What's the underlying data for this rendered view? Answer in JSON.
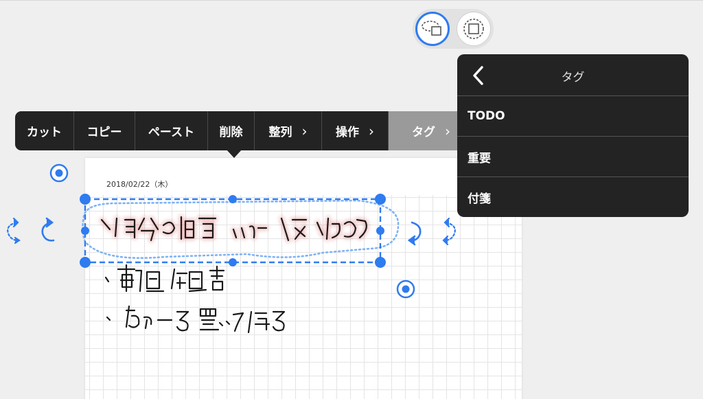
{
  "selection_mode": {
    "options": [
      {
        "name": "lasso",
        "icon": "lasso-select-icon",
        "selected": true
      },
      {
        "name": "rectangle",
        "icon": "rectangle-select-icon",
        "selected": false
      }
    ]
  },
  "context_menu": {
    "items": [
      {
        "id": "cut",
        "label": "カット",
        "has_submenu": false
      },
      {
        "id": "copy",
        "label": "コピー",
        "has_submenu": false
      },
      {
        "id": "paste",
        "label": "ペースト",
        "has_submenu": false
      },
      {
        "id": "delete",
        "label": "削除",
        "has_submenu": false
      },
      {
        "id": "align",
        "label": "整列",
        "has_submenu": true
      },
      {
        "id": "operation",
        "label": "操作",
        "has_submenu": true
      },
      {
        "id": "tag",
        "label": "タグ",
        "has_submenu": true,
        "active": true
      }
    ],
    "submenu_glyph": "›"
  },
  "tag_panel": {
    "title": "タグ",
    "back_icon": "chevron-left-icon",
    "tags": [
      "TODO",
      "重要",
      "付箋"
    ]
  },
  "page": {
    "date": "2018/02/22（木）"
  },
  "colors": {
    "accent": "#2f7bf0",
    "selection_dash": "#7fb2f5",
    "menu_bg": "#232323",
    "menu_active": "#9a9a9a",
    "ink": "#1a1a1a",
    "highlight_glow": "#d85a5a"
  }
}
